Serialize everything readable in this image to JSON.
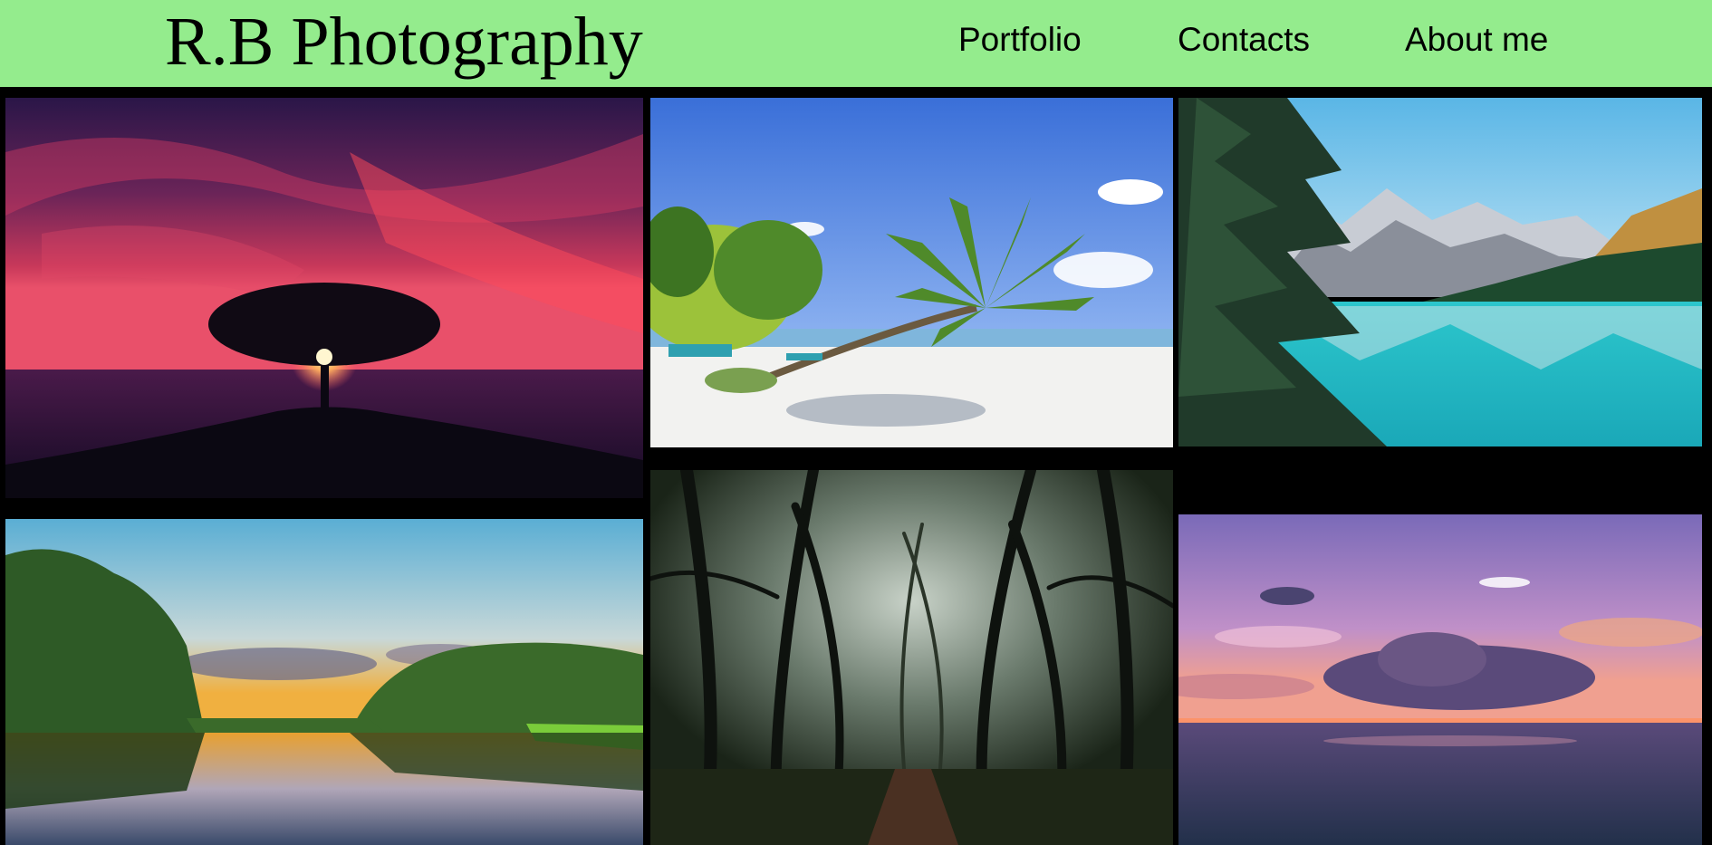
{
  "header": {
    "brand": "R.B Photography",
    "nav": [
      {
        "label": "Portfolio"
      },
      {
        "label": "Contacts"
      },
      {
        "label": "About me"
      }
    ],
    "background_color": "#94ec8d"
  },
  "gallery": {
    "background_color": "#000000",
    "photos": [
      {
        "subject": "tree-sunset"
      },
      {
        "subject": "tropical-beach"
      },
      {
        "subject": "mountain-lake"
      },
      {
        "subject": "jungle-river-sunset"
      },
      {
        "subject": "misty-forest"
      },
      {
        "subject": "ocean-sunset-clouds"
      }
    ]
  }
}
